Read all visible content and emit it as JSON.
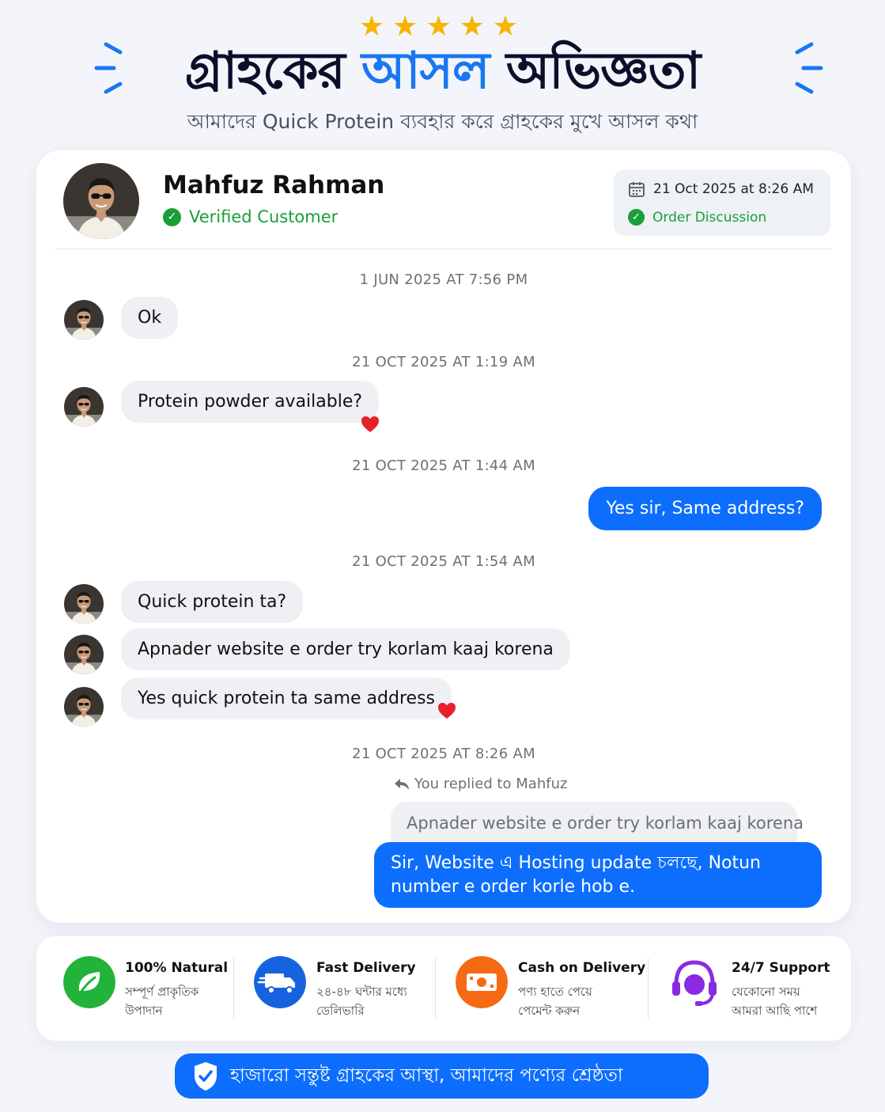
{
  "rating": {
    "stars": "★★★★★",
    "count": 5
  },
  "header": {
    "title_part1": "গ্রাহকের",
    "title_accent": "আসল",
    "title_part2": "অভিজ্ঞতা",
    "subtitle": "আমাদের Quick Protein ব্যবহার করে গ্রাহকের মুখে আসল কথা"
  },
  "colors": {
    "accent": "#1877f2",
    "bubble_out": "#0d6efd",
    "verified": "#1a9e37",
    "star": "#f7b500"
  },
  "customer": {
    "name": "Mahfuz Rahman",
    "badge": "Verified Customer",
    "date": "21 Oct 2025 at 8:26 AM",
    "status": "Order Discussion"
  },
  "chat": {
    "timestamps": [
      "1 JUN 2025 AT 7:56 PM",
      "21 OCT 2025 AT 1:19 AM",
      "21 OCT 2025 AT 1:44 AM",
      "21 OCT 2025 AT 1:54 AM",
      "21 OCT 2025 AT 8:26 AM"
    ],
    "messages": [
      {
        "from": "customer",
        "text": "Ok"
      },
      {
        "from": "customer",
        "text": "Protein powder available?",
        "reaction": "heart"
      },
      {
        "from": "seller",
        "text": "Yes sir, Same address?"
      },
      {
        "from": "customer",
        "text": "Quick protein ta?"
      },
      {
        "from": "customer",
        "text": "Apnader website e order try korlam kaaj korena"
      },
      {
        "from": "customer",
        "text": "Yes quick protein ta same address",
        "reaction": "heart"
      }
    ],
    "reply_note": "You replied to Mahfuz",
    "quoted": "Apnader website e order try korlam kaaj korena",
    "reply_text": "Sir, Website এ Hosting update চলছে, Notun number e order korle hob e."
  },
  "features": [
    {
      "icon": "leaf-icon",
      "title": "100% Natural",
      "line1": "সম্পূর্ণ প্রাকৃতিক",
      "line2": "উপাদান"
    },
    {
      "icon": "truck-icon",
      "title": "Fast Delivery",
      "line1": "২৪-৪৮ ঘন্টার মধ্যে",
      "line2": "ডেলিভারি"
    },
    {
      "icon": "cash-icon",
      "title": "Cash on Delivery",
      "line1": "পণ্য হাতে পেয়ে",
      "line2": "পেমেন্ট করুন"
    },
    {
      "icon": "headset-icon",
      "title": "24/7 Support",
      "line1": "যেকোনো সময়",
      "line2": "আমরা আছি পাশে"
    }
  ],
  "footer": {
    "text": "হাজারো সন্তুষ্ট গ্রাহকের আস্থা, আমাদের পণ্যের শ্রেষ্ঠতা",
    "icon": "shield-check-icon"
  }
}
